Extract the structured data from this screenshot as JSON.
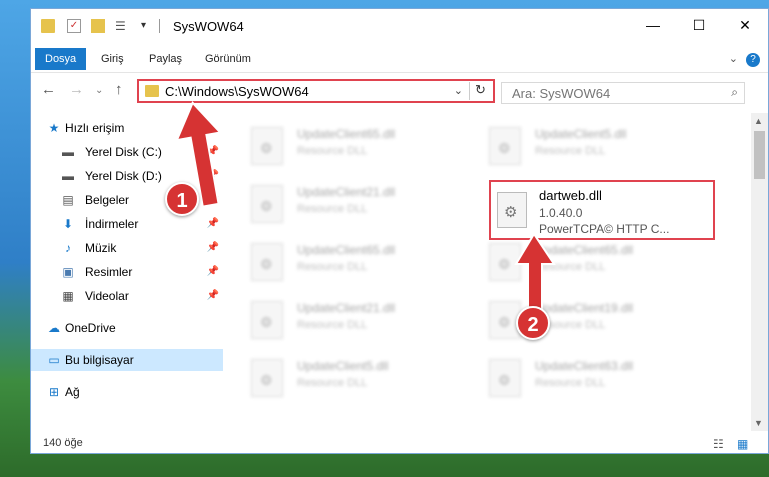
{
  "window": {
    "title": "SysWOW64",
    "minimize": "—",
    "maximize": "☐",
    "close": "✕"
  },
  "ribbon": {
    "tabs": [
      "Dosya",
      "Giriş",
      "Paylaş",
      "Görünüm"
    ],
    "help": "?"
  },
  "navbar": {
    "address": "C:\\Windows\\SysWOW64",
    "search_placeholder": "Ara: SysWOW64"
  },
  "sidebar": {
    "items": [
      {
        "label": "Hızlı erişim",
        "icon": "star-icon"
      },
      {
        "label": "Yerel Disk (C:)",
        "icon": "drive-icon"
      },
      {
        "label": "Yerel Disk (D:)",
        "icon": "drive-icon"
      },
      {
        "label": "Belgeler",
        "icon": "document-icon"
      },
      {
        "label": "İndirmeler",
        "icon": "download-icon"
      },
      {
        "label": "Müzik",
        "icon": "music-icon"
      },
      {
        "label": "Resimler",
        "icon": "pictures-icon"
      },
      {
        "label": "Videolar",
        "icon": "video-icon"
      },
      {
        "label": "OneDrive",
        "icon": "cloud-icon"
      },
      {
        "label": "Bu bilgisayar",
        "icon": "computer-icon"
      },
      {
        "label": "Ağ",
        "icon": "network-icon"
      }
    ]
  },
  "files": {
    "left": [
      {
        "name": "UpdateClient65.dll",
        "type": "Resource DLL"
      },
      {
        "name": "UpdateClient21.dll",
        "type": "Resource DLL"
      },
      {
        "name": "UpdateClient65.dll",
        "type": "Resource DLL"
      },
      {
        "name": "UpdateClient21.dll",
        "type": "Resource DLL"
      },
      {
        "name": "UpdateClient5.dll",
        "type": "Resource DLL"
      }
    ],
    "right": [
      {
        "name": "UpdateClient5.dll",
        "type": "Resource DLL"
      },
      {
        "name": "UpdateClient65.dll",
        "type": "Resource DLL"
      },
      {
        "name": "UpdateClient19.dll",
        "type": "Resource DLL"
      },
      {
        "name": "UpdateClient63.dll",
        "type": "Resource DLL"
      }
    ],
    "highlighted": {
      "name": "dartweb.dll",
      "version": "1.0.40.0",
      "description": "PowerTCPA© HTTP C..."
    }
  },
  "status": {
    "count": "140 öğe"
  },
  "annotations": {
    "badge1": "1",
    "badge2": "2",
    "color": "#d63333"
  }
}
